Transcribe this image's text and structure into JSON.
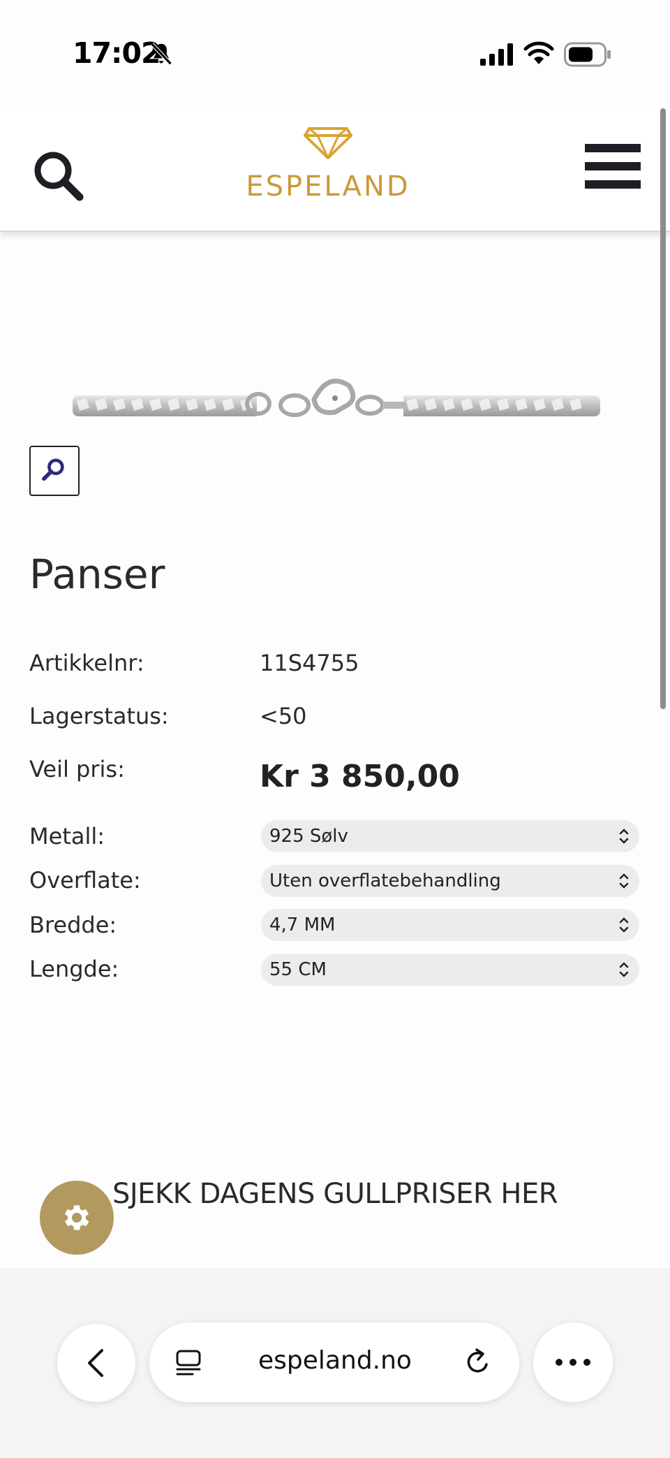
{
  "status_bar": {
    "time": "17:02",
    "icons": [
      "bell-slash-icon",
      "cellular-signal-icon",
      "wifi-icon",
      "battery-icon"
    ]
  },
  "header": {
    "logo_text": "ESPELAND",
    "icons": [
      "search-icon",
      "diamond-logo-icon",
      "hamburger-menu-icon"
    ],
    "brand_color": "#c99a3a"
  },
  "product": {
    "title": "Panser",
    "zoom_icon": "magnifier-icon",
    "specs": [
      {
        "label": "Artikkelnr:",
        "value": "11S4755"
      },
      {
        "label": "Lagerstatus:",
        "value": "<50"
      }
    ],
    "price_label": "Veil pris:",
    "price_value": "Kr 3 850,00",
    "options": [
      {
        "label": "Metall:",
        "selected": "925 Sølv"
      },
      {
        "label": "Overflate:",
        "selected": "Uten overflatebehandling"
      },
      {
        "label": "Bredde:",
        "selected": "4,7 MM"
      },
      {
        "label": "Lengde:",
        "selected": "55 CM"
      }
    ]
  },
  "banner": {
    "text": "SJEKK DAGENS GULLPRISER HER"
  },
  "settings_fab": {
    "icon": "gear-icon",
    "color": "#b29a5e"
  },
  "browser": {
    "url": "espeland.no",
    "icons": [
      "back-chevron-icon",
      "tabs-icon",
      "reload-icon",
      "more-icon"
    ]
  }
}
